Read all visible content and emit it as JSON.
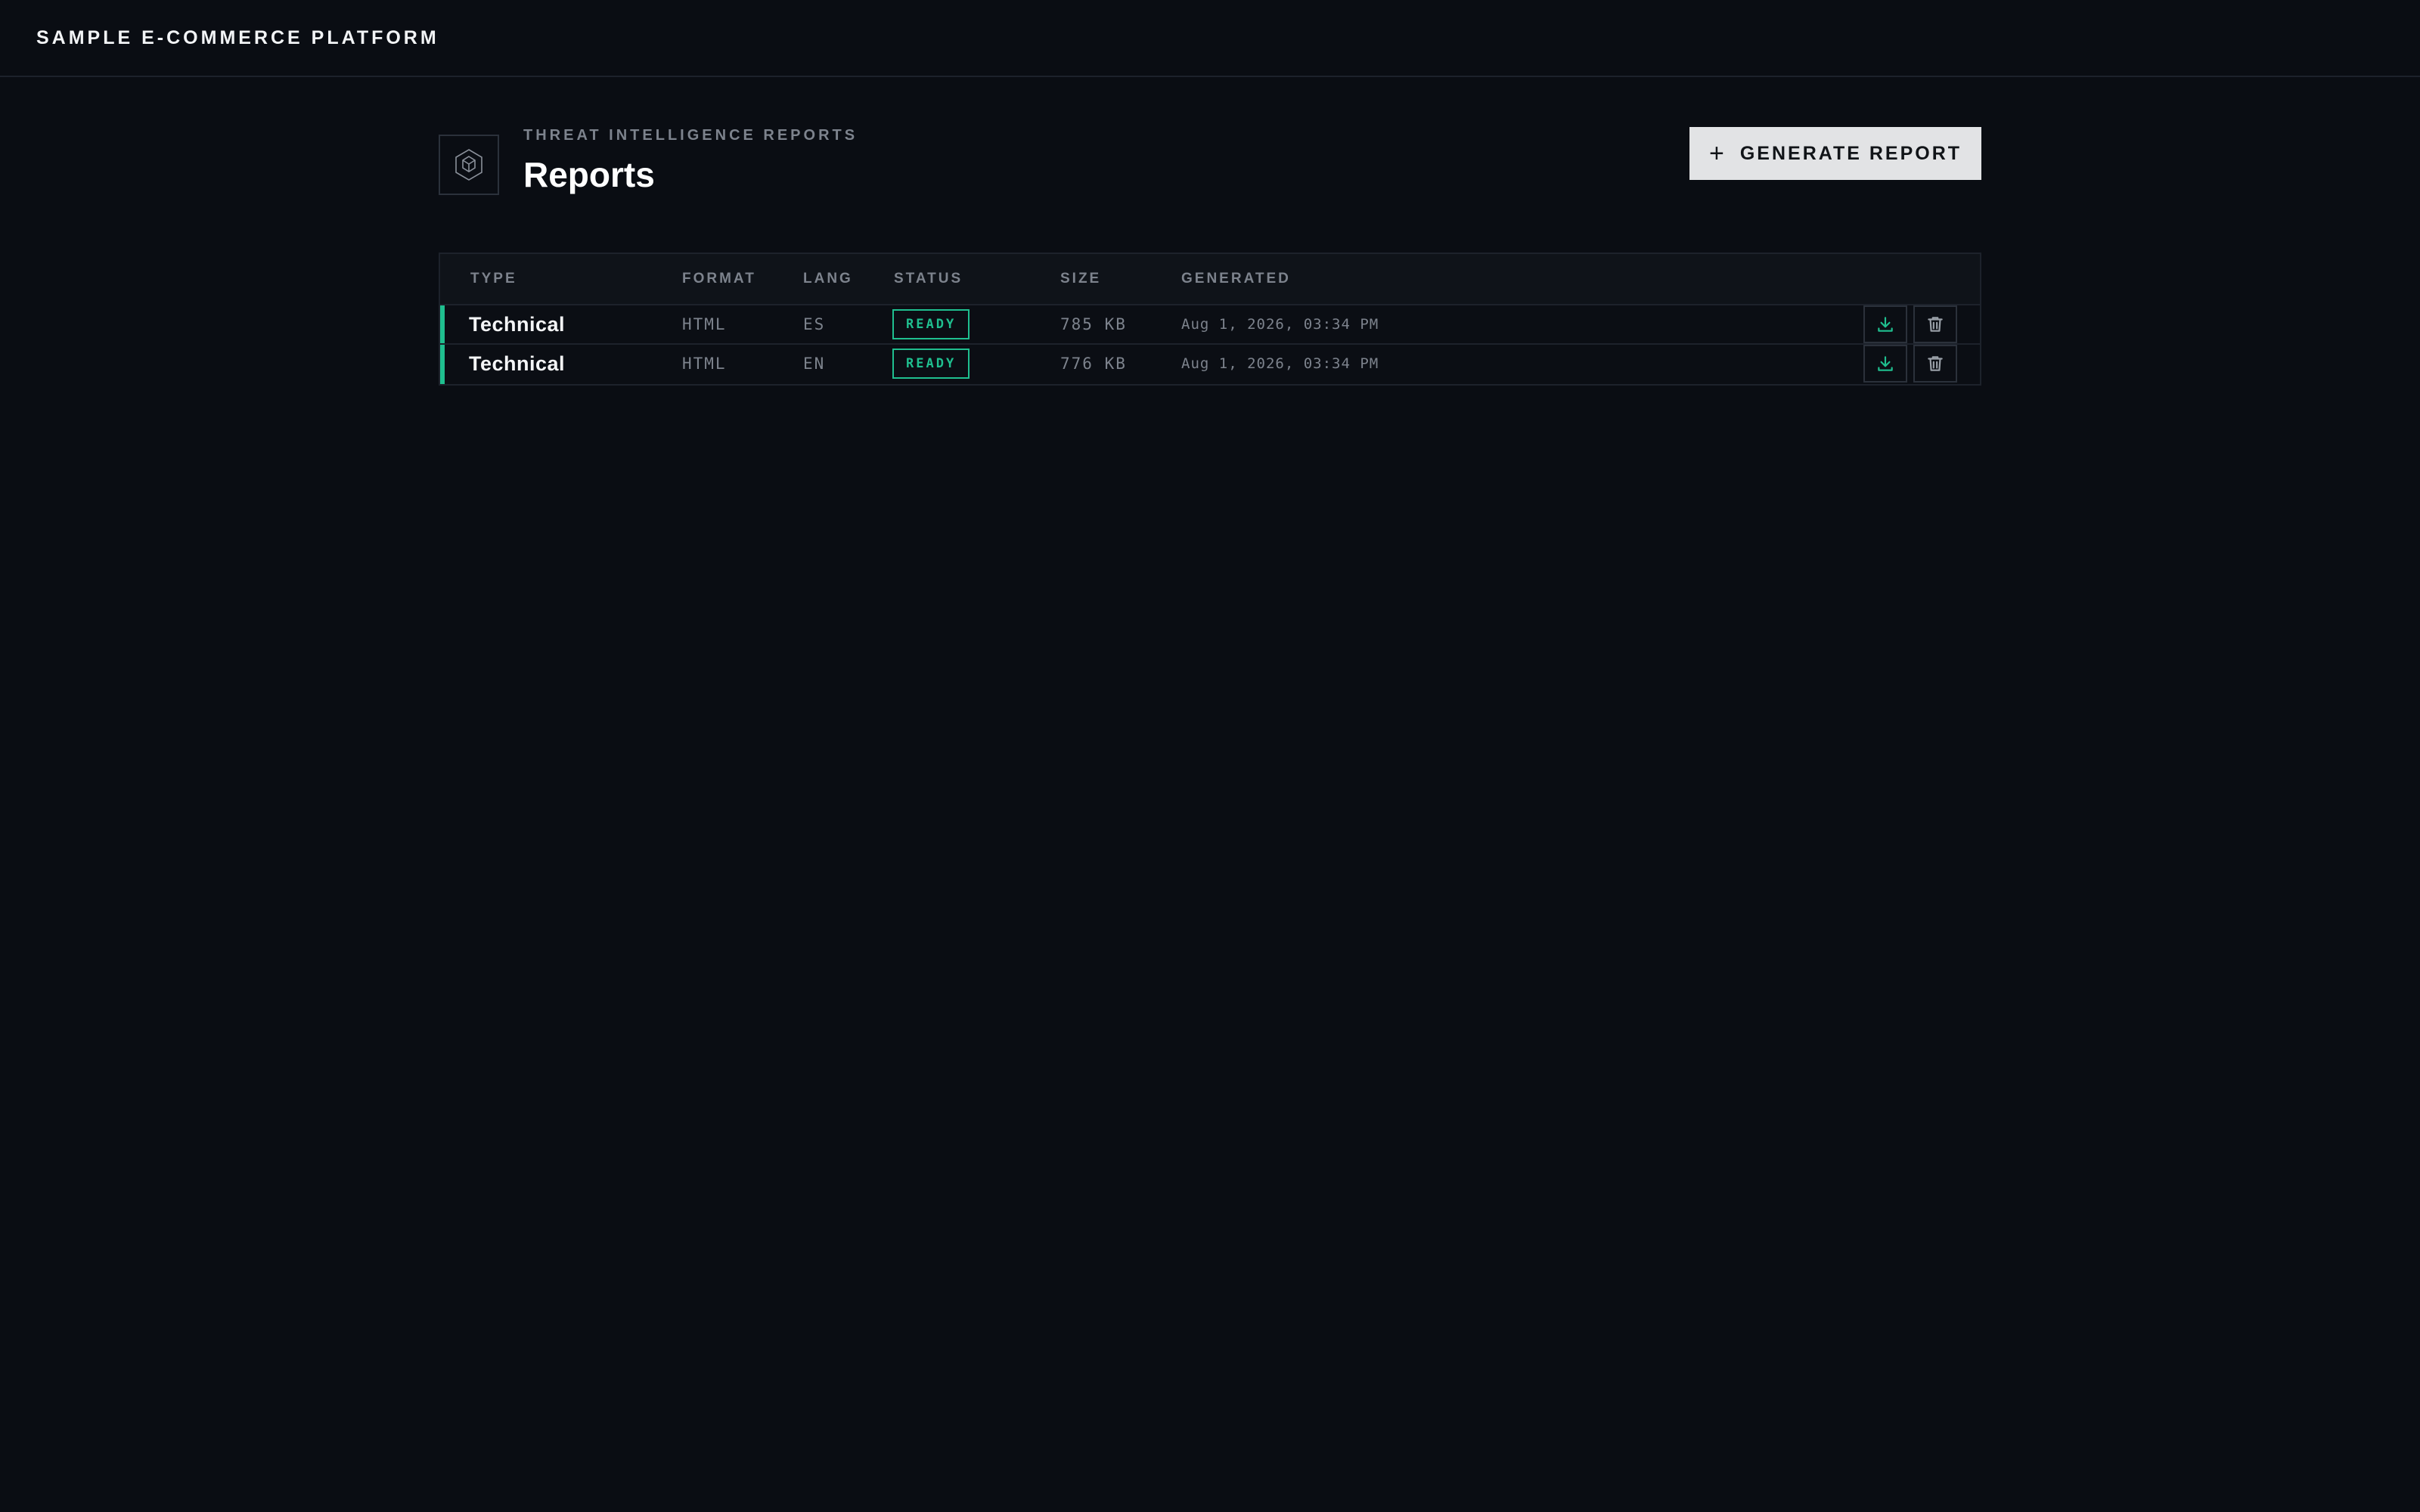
{
  "app": {
    "brand": "SAMPLE E-COMMERCE PLATFORM"
  },
  "header": {
    "eyebrow": "THREAT INTELLIGENCE REPORTS",
    "title": "Reports",
    "generate_label": "GENERATE REPORT",
    "logo_icon": "hexagon-cube-icon"
  },
  "table": {
    "columns": [
      "TYPE",
      "FORMAT",
      "LANG",
      "STATUS",
      "SIZE",
      "GENERATED"
    ],
    "rows": [
      {
        "type": "Technical",
        "format": "HTML",
        "lang": "ES",
        "status": "READY",
        "size": "785 KB",
        "generated": "Aug 1, 2026, 03:34 PM"
      },
      {
        "type": "Technical",
        "format": "HTML",
        "lang": "EN",
        "status": "READY",
        "size": "776 KB",
        "generated": "Aug 1, 2026, 03:34 PM"
      }
    ],
    "actions": [
      "download-icon",
      "trash-icon"
    ]
  },
  "colors": {
    "background": "#0a0d13",
    "accent": "#1fbf8f",
    "button": "#e2e3e5",
    "muted_text": "#7d838d"
  }
}
